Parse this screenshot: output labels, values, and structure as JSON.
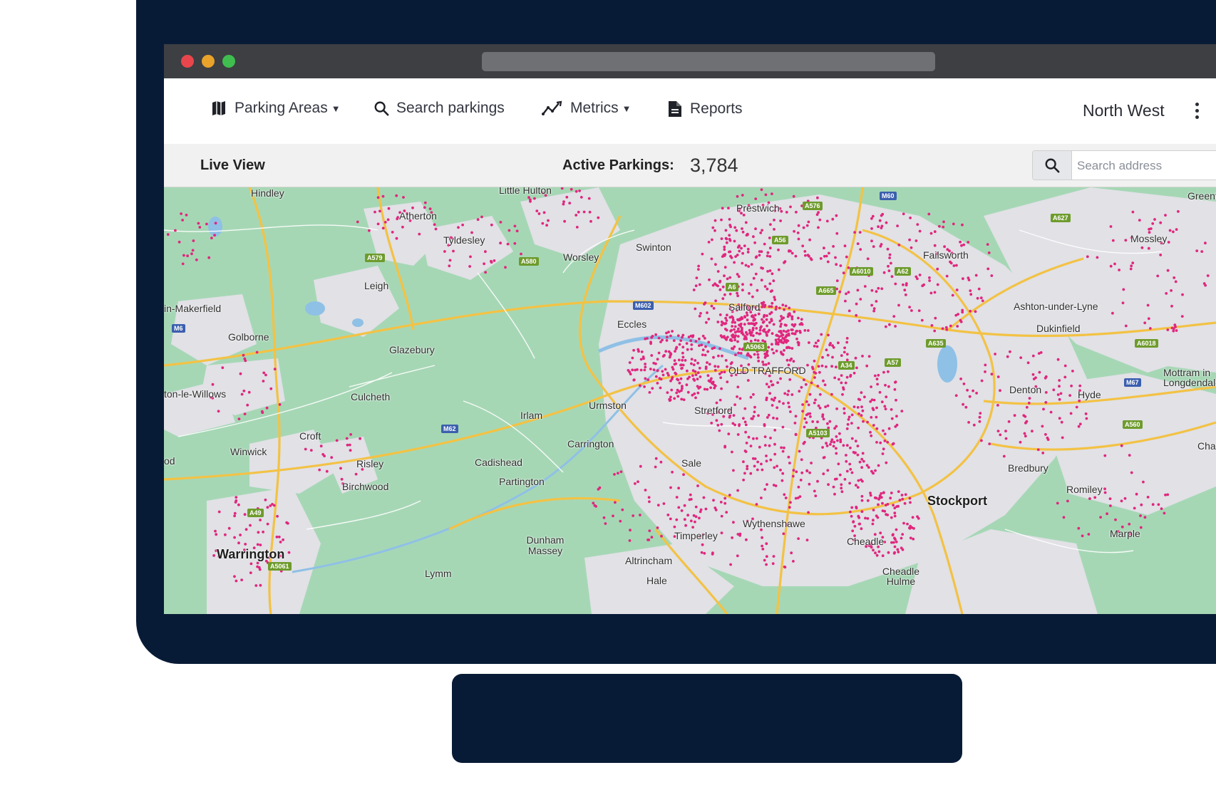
{
  "navbar": {
    "items": [
      {
        "label": "Parking Areas",
        "icon": "map-icon",
        "dropdown": true
      },
      {
        "label": "Search parkings",
        "icon": "search-icon",
        "dropdown": false
      },
      {
        "label": "Metrics",
        "icon": "trend-icon",
        "dropdown": true
      },
      {
        "label": "Reports",
        "icon": "document-icon",
        "dropdown": false
      }
    ],
    "region": "North West"
  },
  "subbar": {
    "live_view": "Live View",
    "active_label": "Active Parkings:",
    "active_value": "3,784",
    "search_placeholder": "Search address"
  },
  "colors": {
    "frame": "#081b36",
    "map_green": "#a6d7b5",
    "urban": "#e2e2e6",
    "parking_dot": "#e0267d",
    "road_major": "#f3c244"
  },
  "map": {
    "places": [
      {
        "name": "Hindley"
      },
      {
        "name": "Little Hulton"
      },
      {
        "name": "Prestwich"
      },
      {
        "name": "Atherton"
      },
      {
        "name": "Tyldesley"
      },
      {
        "name": "Worsley"
      },
      {
        "name": "Swinton"
      },
      {
        "name": "Failsworth"
      },
      {
        "name": "Mossley"
      },
      {
        "name": "Leigh"
      },
      {
        "name": "Salford"
      },
      {
        "name": "Ashton-under-Lyne"
      },
      {
        "name": "in-Makerfield"
      },
      {
        "name": "Eccles"
      },
      {
        "name": "Dukinfield"
      },
      {
        "name": "Golborne"
      },
      {
        "name": "Glazebury"
      },
      {
        "name": "OLD TRAFFORD"
      },
      {
        "name": "Mottram in Longdendale"
      },
      {
        "name": "ton-le-Willows"
      },
      {
        "name": "Culcheth"
      },
      {
        "name": "Urmston"
      },
      {
        "name": "Stretford"
      },
      {
        "name": "Denton"
      },
      {
        "name": "Hyde"
      },
      {
        "name": "Irlam"
      },
      {
        "name": "Croft"
      },
      {
        "name": "Carrington"
      },
      {
        "name": "Winwick"
      },
      {
        "name": "Risley"
      },
      {
        "name": "Cadishead"
      },
      {
        "name": "Sale"
      },
      {
        "name": "Bredbury"
      },
      {
        "name": "Birchwood"
      },
      {
        "name": "Partington"
      },
      {
        "name": "Romiley"
      },
      {
        "name": "Stockport"
      },
      {
        "name": "Wythenshawe"
      },
      {
        "name": "Timperley"
      },
      {
        "name": "Marple"
      },
      {
        "name": "Warrington"
      },
      {
        "name": "Dunham Massey"
      },
      {
        "name": "Cheadle"
      },
      {
        "name": "Altrincham"
      },
      {
        "name": "Lymm"
      },
      {
        "name": "Cheadle Hulme"
      },
      {
        "name": "Hale"
      },
      {
        "name": "Greenf"
      },
      {
        "name": "Char"
      },
      {
        "name": "od"
      }
    ],
    "roads": [
      "A576",
      "M60",
      "A627",
      "A56",
      "A6010",
      "A62",
      "A665",
      "A579",
      "A580",
      "A6",
      "M602",
      "A5063",
      "A635",
      "A6018",
      "M6",
      "A34",
      "A57",
      "M67",
      "M62",
      "A5103",
      "A560",
      "A49",
      "A5061"
    ]
  }
}
